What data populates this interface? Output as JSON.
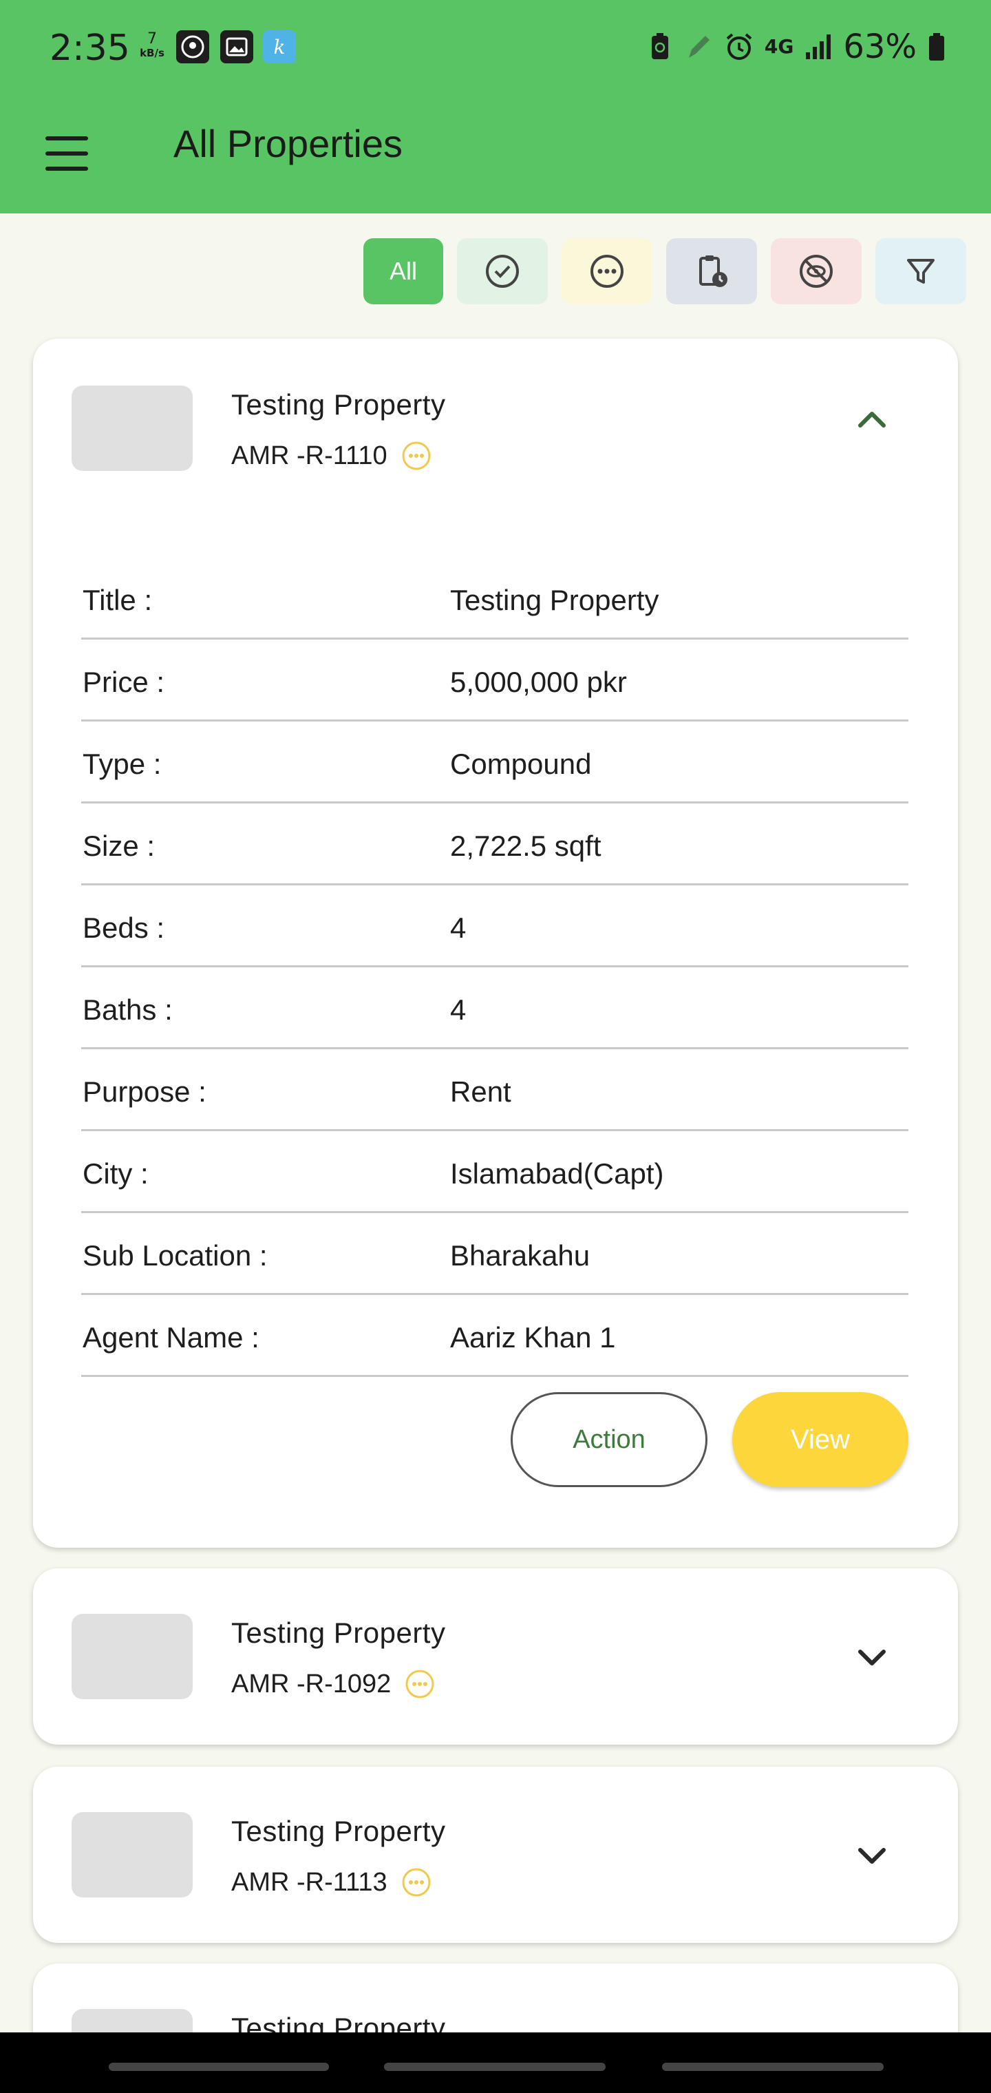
{
  "status_bar": {
    "time": "2:35",
    "net_speed_value": "7",
    "net_speed_unit": "kB/s",
    "network": "4G",
    "battery": "63%"
  },
  "app_bar": {
    "title": "All Properties"
  },
  "filters": {
    "all_label": "All"
  },
  "cards": [
    {
      "title": "Testing Property",
      "code": "AMR -R-1110",
      "expanded": true,
      "details": [
        {
          "label": "Title :",
          "value": "Testing Property"
        },
        {
          "label": "Price :",
          "value": "5,000,000 pkr"
        },
        {
          "label": "Type :",
          "value": "Compound"
        },
        {
          "label": "Size :",
          "value": "2,722.5 sqft"
        },
        {
          "label": "Beds :",
          "value": "4"
        },
        {
          "label": "Baths :",
          "value": "4"
        },
        {
          "label": "Purpose :",
          "value": "Rent"
        },
        {
          "label": "City :",
          "value": "Islamabad(Capt)"
        },
        {
          "label": "Sub Location :",
          "value": "Bharakahu"
        },
        {
          "label": "Agent Name :",
          "value": "Aariz Khan 1"
        }
      ],
      "action_label": "Action",
      "view_label": "View"
    },
    {
      "title": "Testing Property",
      "code": "AMR -R-1092",
      "expanded": false
    },
    {
      "title": "Testing Property",
      "code": "AMR -R-1113",
      "expanded": false
    },
    {
      "title": "Testing Property",
      "code": "",
      "expanded": false
    }
  ],
  "colors": {
    "primary_green": "#58c463",
    "pending_yellow": "#f2c94c",
    "view_button": "#fdd63c"
  }
}
